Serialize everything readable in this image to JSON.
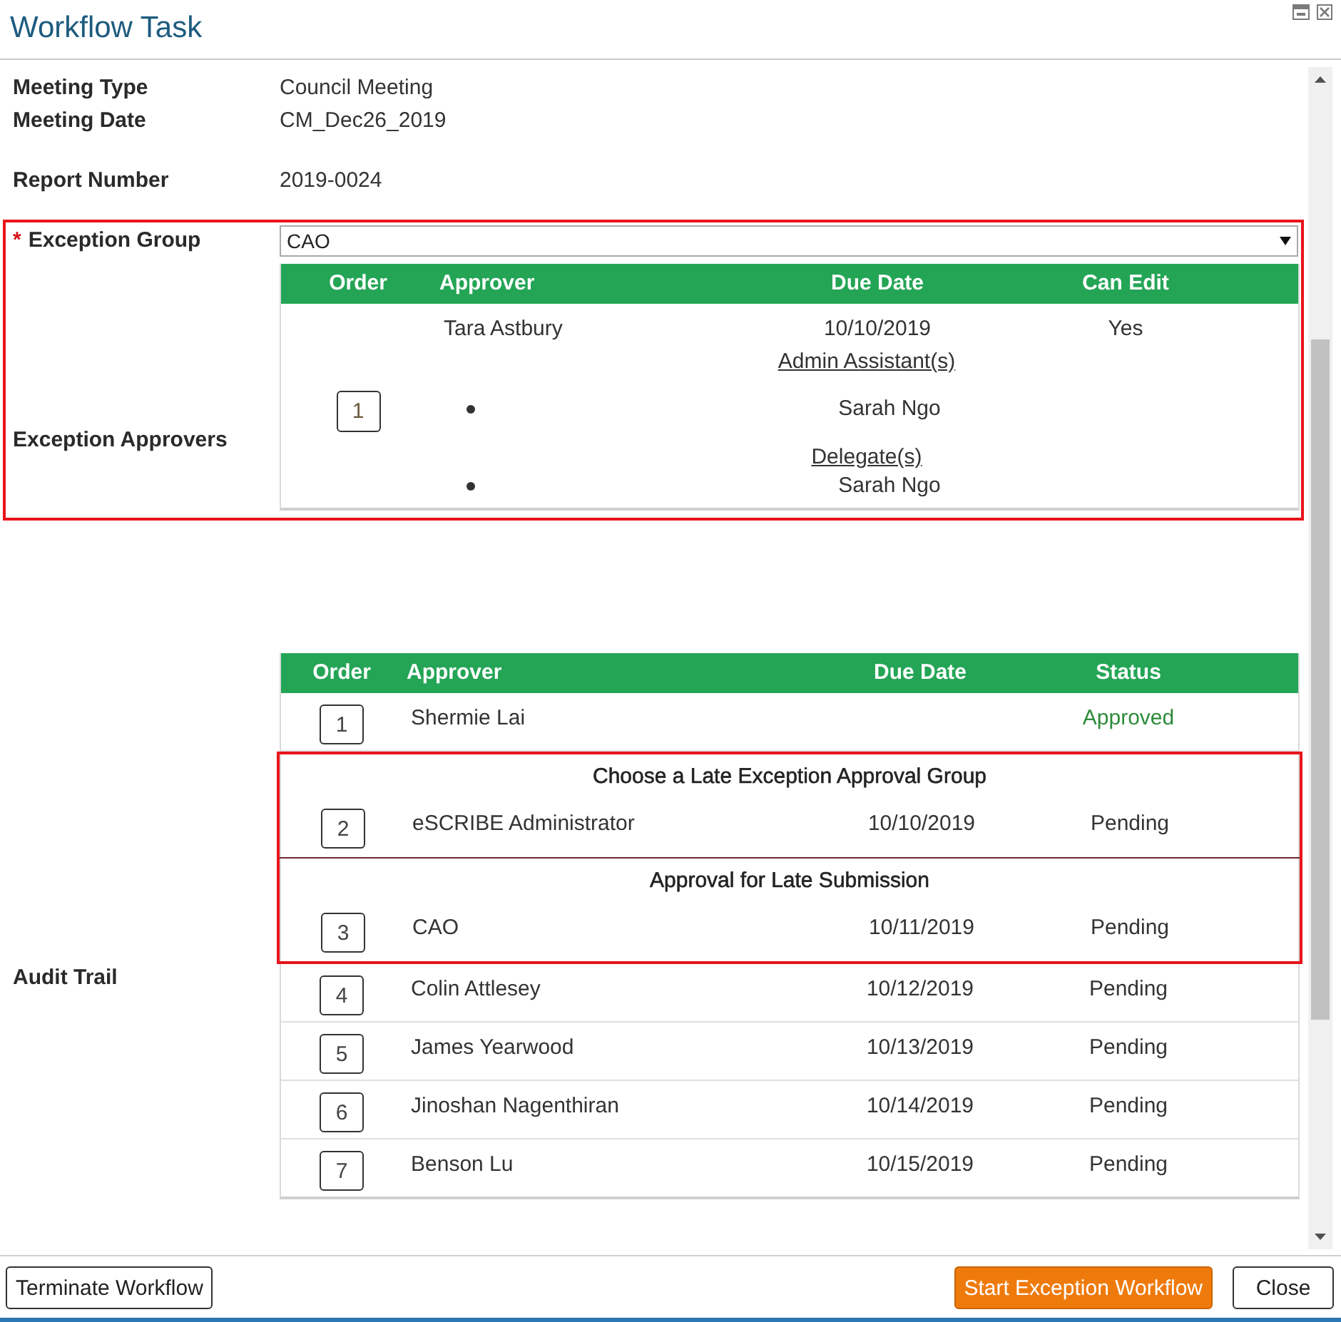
{
  "window": {
    "title": "Workflow Task"
  },
  "details": {
    "meeting_fields": [
      {
        "label": "Meeting Type",
        "value": "Council Meeting"
      },
      {
        "label": "Meeting Date",
        "value": "CM_Dec26_2019"
      }
    ],
    "report_number": {
      "label": "Report Number",
      "value": "2019-0024"
    }
  },
  "exception": {
    "highlighted": true,
    "group_field": {
      "required_mark": "*",
      "label": "Exception Group",
      "value": "CAO"
    },
    "approvers": {
      "label": "Exception Approvers",
      "columns": [
        "Order",
        "Approver",
        "Due Date",
        "Can Edit"
      ],
      "rows": [
        {
          "order": "1",
          "approver": "Tara Astbury",
          "due_date": "10/10/2019",
          "can_edit": "Yes",
          "sublists": [
            {
              "heading": "Admin Assistant(s)",
              "names": [
                "Sarah Ngo"
              ]
            },
            {
              "heading": "Delegate(s)",
              "names": [
                "Sarah Ngo"
              ]
            }
          ]
        }
      ]
    }
  },
  "audit_trail": {
    "label": "Audit Trail",
    "columns": [
      "Order",
      "Approver",
      "Due Date",
      "Status"
    ],
    "rows": [
      {
        "order": "1",
        "approver": "Shermie Lai",
        "status": "Approved",
        "approved": true,
        "highlighted": false
      },
      {
        "heading": "Choose a Late Exception Approval Group",
        "order": "2",
        "approver": "eSCRIBE Administrator",
        "due_date": "10/10/2019",
        "status": "Pending",
        "approved": false,
        "highlighted": true
      },
      {
        "heading": "Approval for Late Submission",
        "order": "3",
        "approver": "CAO",
        "due_date": "10/11/2019",
        "status": "Pending",
        "approved": false,
        "highlighted": true
      },
      {
        "order": "4",
        "approver": "Colin Attlesey",
        "due_date": "10/12/2019",
        "status": "Pending",
        "approved": false,
        "highlighted": false
      },
      {
        "order": "5",
        "approver": "James Yearwood",
        "due_date": "10/13/2019",
        "status": "Pending",
        "approved": false,
        "highlighted": false
      },
      {
        "order": "6",
        "approver": "Jinoshan Nagenthiran",
        "due_date": "10/14/2019",
        "status": "Pending",
        "approved": false,
        "highlighted": false
      },
      {
        "order": "7",
        "approver": "Benson Lu",
        "due_date": "10/15/2019",
        "status": "Pending",
        "approved": false,
        "highlighted": false
      }
    ]
  },
  "footer": {
    "left_buttons": [
      {
        "label": "Terminate Workflow",
        "kind": "default"
      }
    ],
    "right_buttons": [
      {
        "label": "Start Exception Workflow",
        "kind": "primary"
      },
      {
        "label": "Close",
        "kind": "default"
      }
    ]
  }
}
